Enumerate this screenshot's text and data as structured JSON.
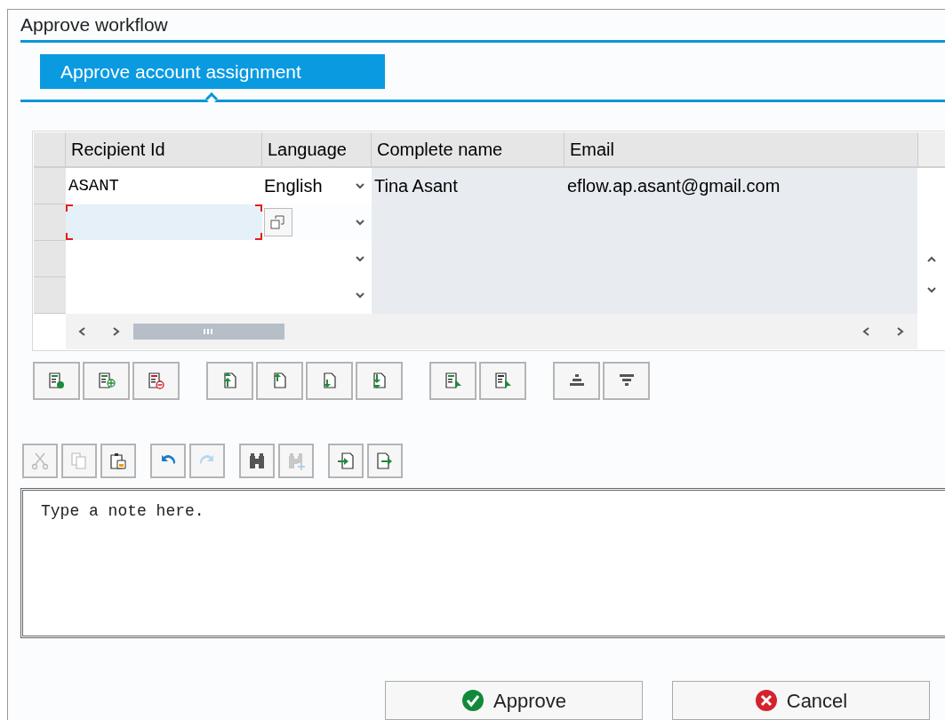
{
  "window": {
    "title": "Approve workflow"
  },
  "tabs": [
    {
      "label": "Approve account assignment",
      "selected": true
    }
  ],
  "table": {
    "columns": [
      "Recipient Id",
      "Language",
      "Complete name",
      "Email"
    ],
    "rows": [
      {
        "recipient_id": "ASANT",
        "language": "English",
        "complete_name": "Tina Asant",
        "email": "eflow.ap.asant@gmail.com",
        "focused": false
      },
      {
        "focused": true
      },
      {
        "focused": false
      },
      {
        "focused": false
      }
    ]
  },
  "table_toolbar": [
    [
      {
        "kind": "append-row",
        "disabled": false
      },
      {
        "kind": "insert-row",
        "disabled": false
      },
      {
        "kind": "delete-row",
        "disabled": false
      }
    ],
    [
      {
        "kind": "move-top",
        "disabled": false
      },
      {
        "kind": "move-up",
        "disabled": false
      },
      {
        "kind": "move-down",
        "disabled": false
      },
      {
        "kind": "move-bottom",
        "disabled": false
      }
    ],
    [
      {
        "kind": "select-all",
        "disabled": false
      },
      {
        "kind": "deselect-all",
        "disabled": false
      }
    ],
    [
      {
        "kind": "sort-ascending",
        "disabled": false
      },
      {
        "kind": "sort-descending",
        "disabled": false
      }
    ]
  ],
  "editor_toolbar": [
    [
      {
        "kind": "cut",
        "disabled": true
      },
      {
        "kind": "copy",
        "disabled": true
      },
      {
        "kind": "paste",
        "disabled": false
      }
    ],
    [
      {
        "kind": "undo",
        "disabled": false
      },
      {
        "kind": "redo",
        "disabled": true
      }
    ],
    [
      {
        "kind": "find",
        "disabled": false
      },
      {
        "kind": "find-next",
        "disabled": true
      }
    ],
    [
      {
        "kind": "import",
        "disabled": false
      },
      {
        "kind": "export",
        "disabled": false
      }
    ]
  ],
  "note": {
    "value": "Type a note here."
  },
  "buttons": [
    {
      "kind": "approve",
      "label": "Approve"
    },
    {
      "kind": "cancel",
      "label": "Cancel"
    }
  ]
}
